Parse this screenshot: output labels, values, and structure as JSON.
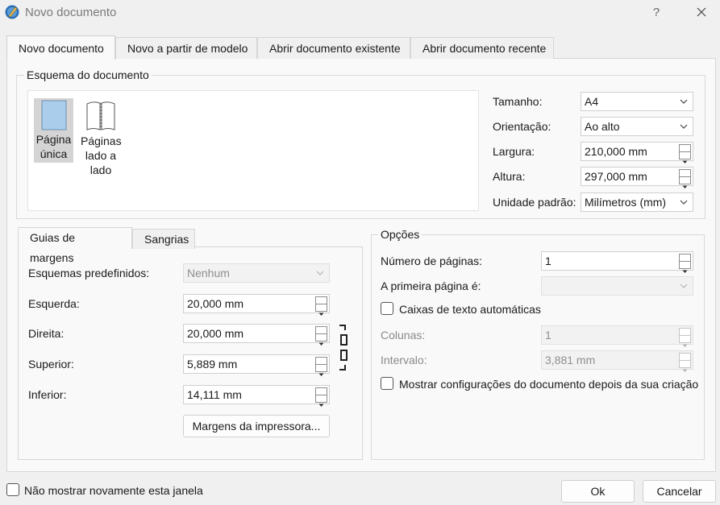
{
  "window": {
    "title": "Novo documento",
    "help_label": "?",
    "close_icon": "close-icon",
    "app_icon": "scribus-icon"
  },
  "tabs": [
    {
      "label": "Novo documento",
      "active": true
    },
    {
      "label": "Novo a partir de modelo",
      "active": false
    },
    {
      "label": "Abrir documento existente",
      "active": false
    },
    {
      "label": "Abrir documento recente",
      "active": false
    }
  ],
  "layout": {
    "group_title": "Esquema do documento",
    "items": [
      {
        "label": "Página única",
        "icon": "single-page-icon",
        "selected": true
      },
      {
        "label": "Páginas lado a lado",
        "icon": "facing-pages-icon",
        "selected": false
      }
    ]
  },
  "page_settings": {
    "size_label": "Tamanho:",
    "size_value": "A4",
    "orientation_label": "Orientação:",
    "orientation_value": "Ao alto",
    "width_label": "Largura:",
    "width_value": "210,000 mm",
    "height_label": "Altura:",
    "height_value": "297,000 mm",
    "unit_label": "Unidade padrão:",
    "unit_value": "Milímetros (mm)"
  },
  "margins": {
    "tabs": [
      {
        "label": "Guias de margens",
        "active": true
      },
      {
        "label": "Sangrias",
        "active": false
      }
    ],
    "preset_label": "Esquemas predefinidos:",
    "preset_value": "Nenhum",
    "left_label": "Esquerda:",
    "left_value": "20,000 mm",
    "right_label": "Direita:",
    "right_value": "20,000 mm",
    "top_label": "Superior:",
    "top_value": "5,889 mm",
    "bottom_label": "Inferior:",
    "bottom_value": "14,111 mm",
    "printer_button": "Margens da impressora...",
    "link_icon": "chain-link-icon"
  },
  "options": {
    "group_title": "Opções",
    "pages_label": "Número de páginas:",
    "pages_value": "1",
    "first_page_label": "A primeira página é:",
    "first_page_value": "",
    "auto_text_label": "Caixas de texto automáticas",
    "auto_text_checked": false,
    "columns_label": "Colunas:",
    "columns_value": "1",
    "gap_label": "Intervalo:",
    "gap_value": "3,881 mm",
    "show_settings_label": "Mostrar configurações do documento depois da sua criação",
    "show_settings_checked": false
  },
  "footer": {
    "dont_show_label": "Não mostrar novamente esta janela",
    "dont_show_checked": false,
    "ok_label": "Ok",
    "cancel_label": "Cancelar"
  }
}
